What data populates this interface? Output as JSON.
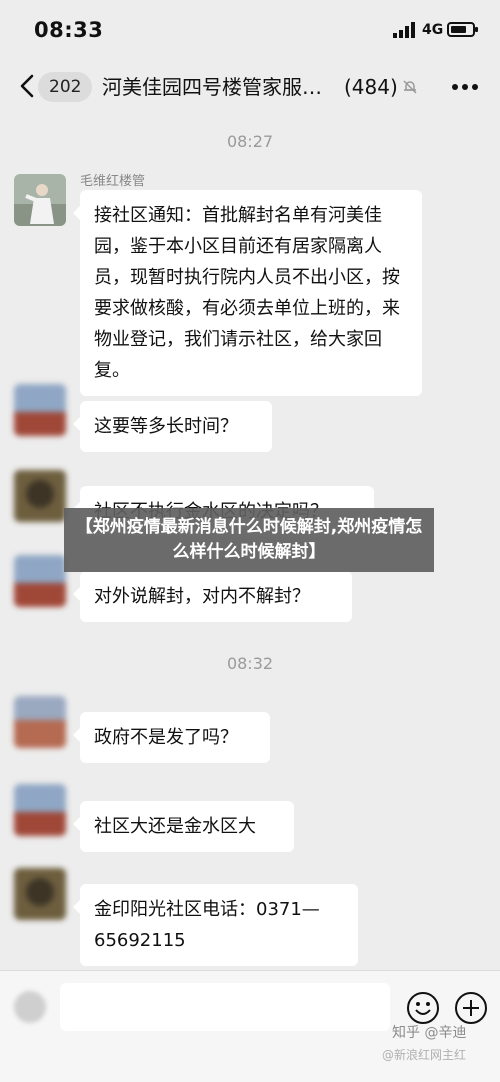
{
  "status_bar": {
    "time": "08:33",
    "network": "4G",
    "battery_level": 0.75
  },
  "nav": {
    "unread_badge": "202",
    "title": "河美佳园四号楼管家服…",
    "member_count": "(484)",
    "icons": [
      "back-chevron-icon",
      "mute-bell-icon",
      "more-icon"
    ]
  },
  "timestamps": {
    "t1": "08:27",
    "t2": "08:32"
  },
  "messages": [
    {
      "sender": "毛维红楼管",
      "text": "接社区通知：首批解封名单有河美佳园，鉴于本小区目前还有居家隔离人员，现暂时执行院内人员不出小区，按要求做核酸，有必须去单位上班的，来物业登记，我们请示社区，给大家回复。"
    },
    {
      "text": "这要等多长时间？"
    },
    {
      "text": "社区不执行金水区的决定吗？"
    },
    {
      "text": "对外说解封，对内不解封？"
    },
    {
      "text": "政府不是发了吗？"
    },
    {
      "text": "社区大还是金水区大"
    },
    {
      "text": "金印阳光社区电话：0371—65692115"
    }
  ],
  "overlay_title": "【郑州疫情最新消息什么时候解封,郑州疫情怎么样什么时候解封】",
  "watermark": {
    "line1": "知乎 @辛迪",
    "line2": "@新浪红网主红"
  },
  "input_icons": [
    "voice-icon",
    "emoji-icon",
    "plus-icon"
  ]
}
